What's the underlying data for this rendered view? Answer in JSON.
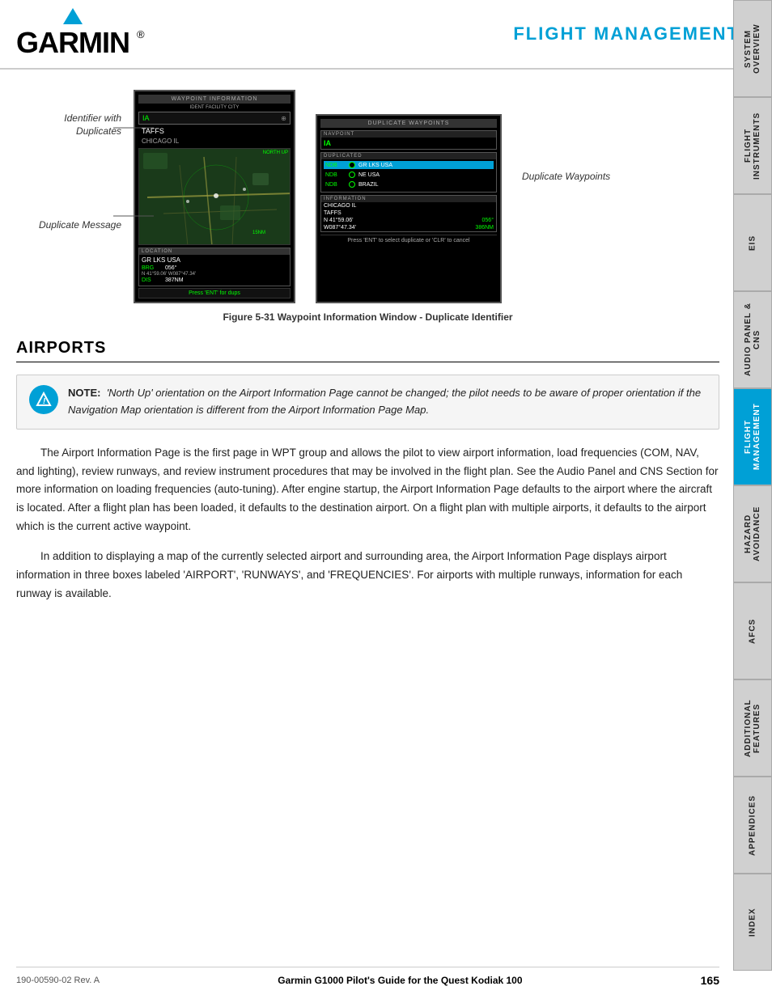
{
  "header": {
    "title": "FLIGHT MANAGEMENT",
    "logo_text": "GARMIN",
    "logo_dot": "®"
  },
  "sidebar": {
    "tabs": [
      {
        "label": "SYSTEM OVERVIEW",
        "active": false
      },
      {
        "label": "FLIGHT INSTRUMENTS",
        "active": false
      },
      {
        "label": "EIS",
        "active": false
      },
      {
        "label": "AUDIO PANEL & CNS",
        "active": false
      },
      {
        "label": "FLIGHT MANAGEMENT",
        "active": true
      },
      {
        "label": "HAZARD AVOIDANCE",
        "active": false
      },
      {
        "label": "AFCS",
        "active": false
      },
      {
        "label": "ADDITIONAL FEATURES",
        "active": false
      },
      {
        "label": "APPENDICES",
        "active": false
      },
      {
        "label": "INDEX",
        "active": false
      }
    ]
  },
  "figure": {
    "caption": "Figure 5-31  Waypoint Information Window - Duplicate Identifier",
    "annotations": {
      "identifier": "Identifier with Duplicates",
      "duplicate_waypoints": "Duplicate Waypoints",
      "duplicate_message": "Duplicate Message"
    },
    "main_screen": {
      "header": "WAYPOINT INFORMATION",
      "tabs": "IDENT  FACILITY  CITY",
      "identifier": "IA",
      "name": "TAFFS",
      "city": "CHICAGO IL",
      "map_label": "NORTH UP",
      "location_header": "LOCATION",
      "location_name": "GR LKS USA",
      "brg_label": "BRG",
      "brg_value": "056°",
      "dis_label": "DIS",
      "dis_value": "387NM",
      "coords": "N 41°59.06'  W087°47.34'",
      "dup_message": "Press 'ENT' for dups"
    },
    "dup_screen": {
      "title": "DUPLICATE WAYPOINTS",
      "navpoint_header": "NAVPOINT",
      "navpoint_value": "IA",
      "duplicates_header": "DUPLICATED",
      "rows": [
        {
          "type": "NDB",
          "location": "GR LKS USA",
          "selected": true
        },
        {
          "type": "NDB",
          "location": "NE USA",
          "selected": false
        },
        {
          "type": "NDB",
          "location": "BRAZIL",
          "selected": false
        }
      ],
      "info_header": "INFORMATION",
      "info_city": "CHICAGO IL",
      "info_name": "TAFFS",
      "info_lat": "N 41°59.06'",
      "info_lon": "W087°47.34'",
      "info_brg": "056°",
      "info_dist": "386NM",
      "instruction": "Press 'ENT' to select duplicate or 'CLR' to cancel"
    }
  },
  "airports_section": {
    "title": "AIRPORTS",
    "note": {
      "label": "NOTE:",
      "text": "'North Up' orientation on the Airport Information Page cannot be changed; the pilot needs to be aware of proper orientation if the Navigation Map orientation is different from the Airport Information Page Map."
    },
    "paragraphs": [
      "The Airport Information Page is the first page in WPT group and allows the pilot to view airport information, load frequencies (COM, NAV, and lighting), review runways, and review instrument procedures that may be involved in the flight plan. See the Audio Panel and CNS Section for more information on loading frequencies (auto-tuning). After engine startup, the Airport Information Page defaults to the airport where the aircraft is located. After a flight plan has been loaded, it defaults to the destination airport.  On a flight plan with multiple airports, it defaults to the airport which is the current active waypoint.",
      "In addition to displaying a map of the currently selected airport and surrounding area, the Airport Information Page displays airport information in three boxes labeled 'AIRPORT', 'RUNWAYS', and 'FREQUENCIES'.  For airports with multiple runways, information for each runway is available."
    ]
  },
  "footer": {
    "left": "190-00590-02  Rev. A",
    "center": "Garmin G1000 Pilot's Guide for the Quest Kodiak 100",
    "right": "165"
  }
}
